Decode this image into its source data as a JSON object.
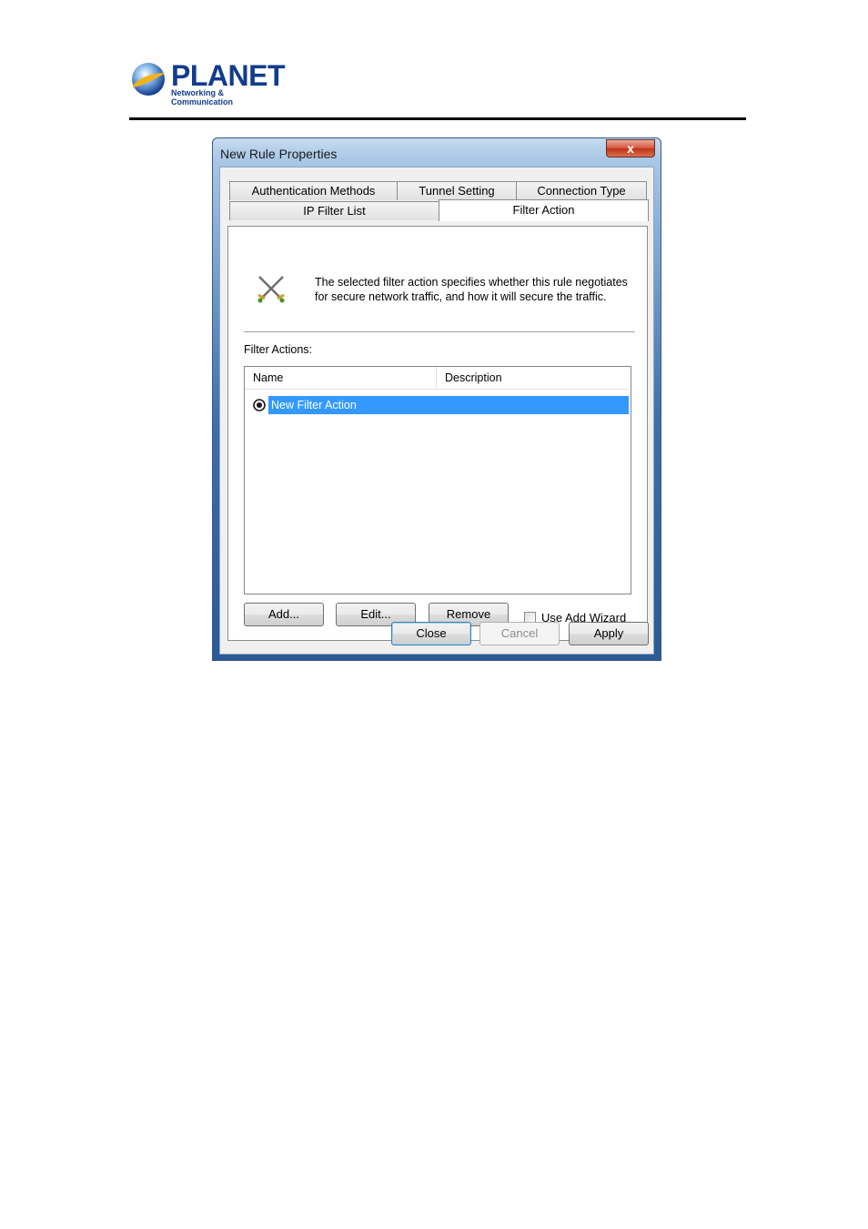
{
  "header": {
    "logo_name": "PLANET",
    "logo_tagline": "Networking & Communication"
  },
  "window": {
    "title": "New Rule Properties",
    "close_glyph": "x"
  },
  "tabs": {
    "row1": [
      "Authentication Methods",
      "Tunnel Setting",
      "Connection Type"
    ],
    "row2": [
      "IP Filter List",
      "Filter Action"
    ],
    "active": "Filter Action"
  },
  "panel": {
    "description_line1": "The selected filter action specifies whether this rule negotiates",
    "description_line2": "for secure network traffic, and how it will secure the traffic.",
    "filter_actions_label": "Filter Actions:",
    "list": {
      "columns": [
        "Name",
        "Description"
      ],
      "rows": [
        {
          "name": "New Filter Action",
          "description": "",
          "selected": true
        }
      ]
    },
    "buttons": {
      "add": "Add...",
      "edit": "Edit...",
      "remove": "Remove"
    },
    "use_add_wizard": {
      "label": "Use Add Wizard",
      "checked": false
    }
  },
  "footer": {
    "close": "Close",
    "cancel": "Cancel",
    "apply": "Apply"
  },
  "icons": [
    "planet-logo-icon",
    "window-close-icon",
    "crossed-swords-icon",
    "radio-selected-icon"
  ],
  "colors": {
    "selection": "#3399ff",
    "brand": "#123c8c",
    "close_button": "#c23216"
  }
}
